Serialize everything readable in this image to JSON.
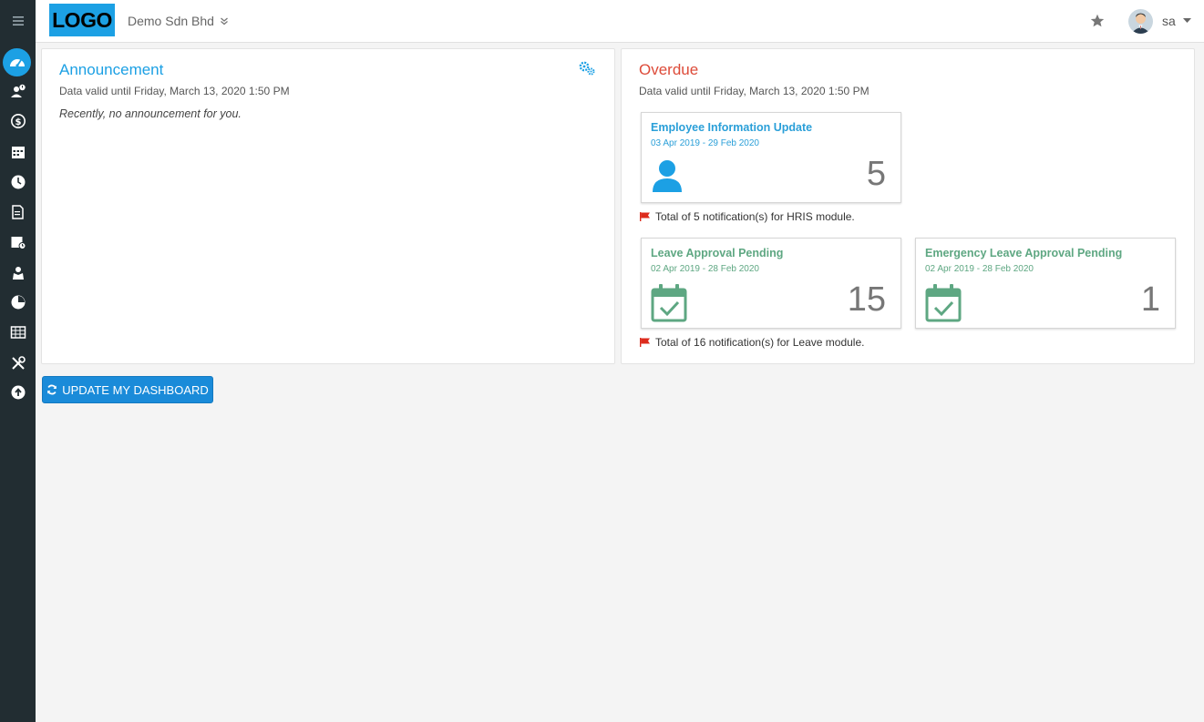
{
  "header": {
    "logo_text": "LOGO",
    "company": "Demo Sdn Bhd",
    "user": "sa"
  },
  "sidebar": {
    "items": [
      {
        "icon": "menu-icon"
      },
      {
        "icon": "dashboard-icon",
        "active": true
      },
      {
        "icon": "employee-alert-icon"
      },
      {
        "icon": "payroll-icon"
      },
      {
        "icon": "calendar-icon"
      },
      {
        "icon": "clock-icon"
      },
      {
        "icon": "document-icon"
      },
      {
        "icon": "leave-calendar-icon"
      },
      {
        "icon": "claims-icon"
      },
      {
        "icon": "report-icon"
      },
      {
        "icon": "spreadsheet-icon"
      },
      {
        "icon": "tools-icon"
      },
      {
        "icon": "upload-icon"
      }
    ]
  },
  "announcement": {
    "title": "Announcement",
    "valid": "Data valid until Friday, March 13, 2020 1:50 PM",
    "text": "Recently, no announcement for you."
  },
  "overdue": {
    "title": "Overdue",
    "valid": "Data valid until Friday, March 13, 2020 1:50 PM",
    "cards": [
      {
        "title": "Employee Information Update",
        "dates": "03 Apr 2019 - 29 Feb 2020",
        "count": "5"
      },
      {
        "title": "Leave Approval Pending",
        "dates": "02 Apr 2019 - 28 Feb 2020",
        "count": "15"
      },
      {
        "title": "Emergency Leave Approval Pending",
        "dates": "02 Apr 2019 - 28 Feb 2020",
        "count": "1"
      }
    ],
    "notes": [
      "Total of 5 notification(s) for HRIS module.",
      "Total of 16 notification(s) for Leave module."
    ]
  },
  "actions": {
    "update_dashboard": "UPDATE MY DASHBOARD"
  },
  "colors": {
    "accent": "#1ca0e4",
    "sidebar": "#222d32",
    "overdue_title": "#dd4b39",
    "hris_card": "#2a9fd8",
    "leave_card": "#5ea782",
    "flag": "#dd2b1c"
  }
}
